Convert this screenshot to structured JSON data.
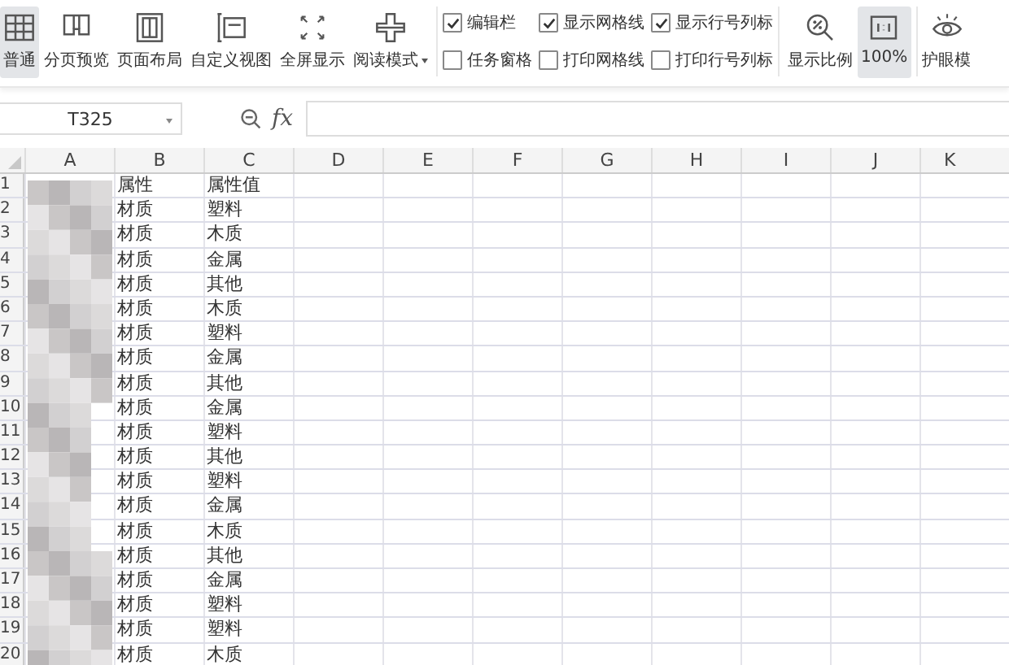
{
  "toolbar": {
    "view_buttons": [
      {
        "label": "普通",
        "selected": true,
        "dropdown": false
      },
      {
        "label": "分页预览",
        "selected": false,
        "dropdown": false
      },
      {
        "label": "页面布局",
        "selected": false,
        "dropdown": false
      },
      {
        "label": "自定义视图",
        "selected": false,
        "dropdown": false
      },
      {
        "label": "全屏显示",
        "selected": false,
        "dropdown": false
      },
      {
        "label": "阅读模式",
        "selected": false,
        "dropdown": true
      }
    ],
    "checkbox_columns": [
      [
        {
          "label": "编辑栏",
          "checked": true
        },
        {
          "label": "任务窗格",
          "checked": false
        }
      ],
      [
        {
          "label": "显示网格线",
          "checked": true
        },
        {
          "label": "打印网格线",
          "checked": false
        }
      ],
      [
        {
          "label": "显示行号列标",
          "checked": true
        },
        {
          "label": "打印行号列标",
          "checked": false
        }
      ]
    ],
    "zoom_buttons": [
      {
        "label": "显示比例",
        "selected": false
      },
      {
        "label": "100%",
        "selected": true
      }
    ],
    "eye_button": {
      "label": "护眼模",
      "selected": false
    }
  },
  "formula_bar": {
    "name_box": "T325",
    "fx": "fx"
  },
  "columns": [
    "A",
    "B",
    "C",
    "D",
    "E",
    "F",
    "G",
    "H",
    "I",
    "J",
    "K"
  ],
  "rows": [
    {
      "number": "1",
      "b": "属性",
      "c": "属性值"
    },
    {
      "number": "2",
      "b": "材质",
      "c": "塑料"
    },
    {
      "number": "3",
      "b": "材质",
      "c": "木质"
    },
    {
      "number": "4",
      "b": "材质",
      "c": "金属"
    },
    {
      "number": "5",
      "b": "材质",
      "c": "其他"
    },
    {
      "number": "6",
      "b": "材质",
      "c": "木质"
    },
    {
      "number": "7",
      "b": "材质",
      "c": "塑料"
    },
    {
      "number": "8",
      "b": "材质",
      "c": "金属"
    },
    {
      "number": "9",
      "b": "材质",
      "c": "其他"
    },
    {
      "number": "10",
      "b": "材质",
      "c": "金属"
    },
    {
      "number": "11",
      "b": "材质",
      "c": "塑料"
    },
    {
      "number": "12",
      "b": "材质",
      "c": "其他"
    },
    {
      "number": "13",
      "b": "材质",
      "c": "塑料"
    },
    {
      "number": "14",
      "b": "材质",
      "c": "金属"
    },
    {
      "number": "15",
      "b": "材质",
      "c": "木质"
    },
    {
      "number": "16",
      "b": "材质",
      "c": "其他"
    },
    {
      "number": "17",
      "b": "材质",
      "c": "金属"
    },
    {
      "number": "18",
      "b": "材质",
      "c": "塑料"
    },
    {
      "number": "19",
      "b": "材质",
      "c": "塑料"
    },
    {
      "number": "20",
      "b": "材质",
      "c": "木质"
    }
  ]
}
